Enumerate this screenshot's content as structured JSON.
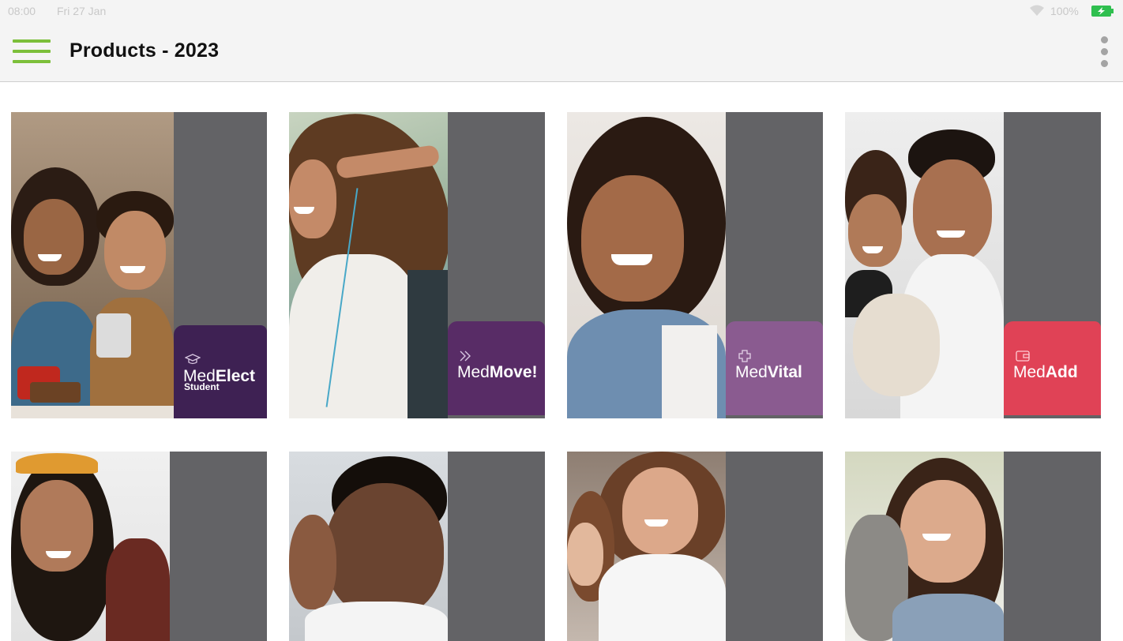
{
  "status_bar": {
    "time": "08:00",
    "date": "Fri 27 Jan",
    "battery": "100%"
  },
  "app_bar": {
    "title": "Products - 2023",
    "accent_color": "#7cbf3a"
  },
  "products": [
    {
      "name_prefix": "Med",
      "name_suffix": "Elect",
      "subtitle": "Student",
      "color": "#3e2153",
      "icon": "graduation-cap-icon"
    },
    {
      "name_prefix": "Med",
      "name_suffix": "Move!",
      "subtitle": "",
      "color": "#582c66",
      "icon": "chevrons-right-icon"
    },
    {
      "name_prefix": "Med",
      "name_suffix": "Vital",
      "subtitle": "",
      "color": "#8a5b90",
      "icon": "plus-cross-icon"
    },
    {
      "name_prefix": "Med",
      "name_suffix": "Add",
      "subtitle": "",
      "color": "#e04256",
      "icon": "wallet-icon"
    }
  ]
}
